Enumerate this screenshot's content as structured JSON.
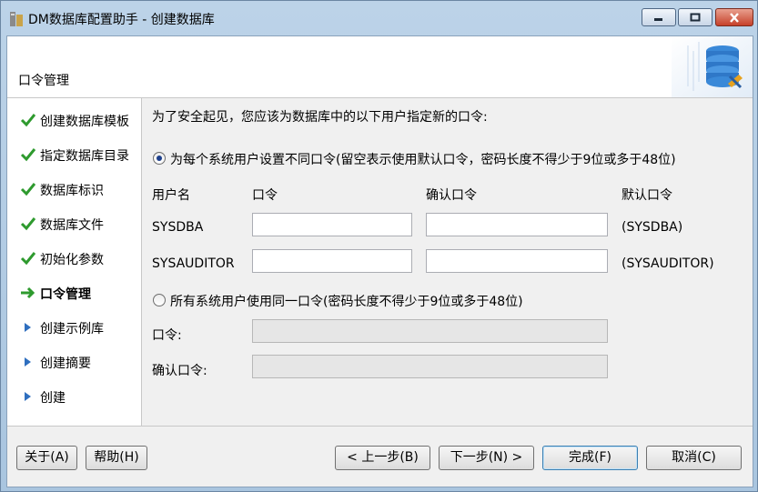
{
  "window": {
    "title": "DM数据库配置助手 - 创建数据库"
  },
  "header": {
    "title": "口令管理"
  },
  "steps": [
    {
      "label": "创建数据库模板",
      "state": "done"
    },
    {
      "label": "指定数据库目录",
      "state": "done"
    },
    {
      "label": "数据库标识",
      "state": "done"
    },
    {
      "label": "数据库文件",
      "state": "done"
    },
    {
      "label": "初始化参数",
      "state": "done"
    },
    {
      "label": "口令管理",
      "state": "current"
    },
    {
      "label": "创建示例库",
      "state": "pending"
    },
    {
      "label": "创建摘要",
      "state": "pending"
    },
    {
      "label": "创建",
      "state": "pending"
    }
  ],
  "main": {
    "intro": "为了安全起见，您应该为数据库中的以下用户指定新的口令:",
    "option_individual": {
      "label": "为每个系统用户设置不同口令(留空表示使用默认口令，密码长度不得少于9位或多于48位)",
      "selected": true
    },
    "columns": {
      "user": "用户名",
      "password": "口令",
      "confirm": "确认口令",
      "default": "默认口令"
    },
    "users": [
      {
        "name": "SYSDBA",
        "password": "",
        "confirm": "",
        "default": "(SYSDBA)"
      },
      {
        "name": "SYSAUDITOR",
        "password": "",
        "confirm": "",
        "default": "(SYSAUDITOR)"
      }
    ],
    "option_same": {
      "label": "所有系统用户使用同一口令(密码长度不得少于9位或多于48位)",
      "selected": false
    },
    "same_password_label": "口令:",
    "same_confirm_label": "确认口令:",
    "same_password_value": "",
    "same_confirm_value": ""
  },
  "buttons": {
    "about": "关于(A)",
    "help": "帮助(H)",
    "back": "< 上一步(B)",
    "next": "下一步(N) >",
    "finish": "完成(F)",
    "cancel": "取消(C)"
  },
  "colors": {
    "check": "#2e9a2e",
    "arrow": "#2e9a2e",
    "pending_marker": "#2f6fbf"
  }
}
